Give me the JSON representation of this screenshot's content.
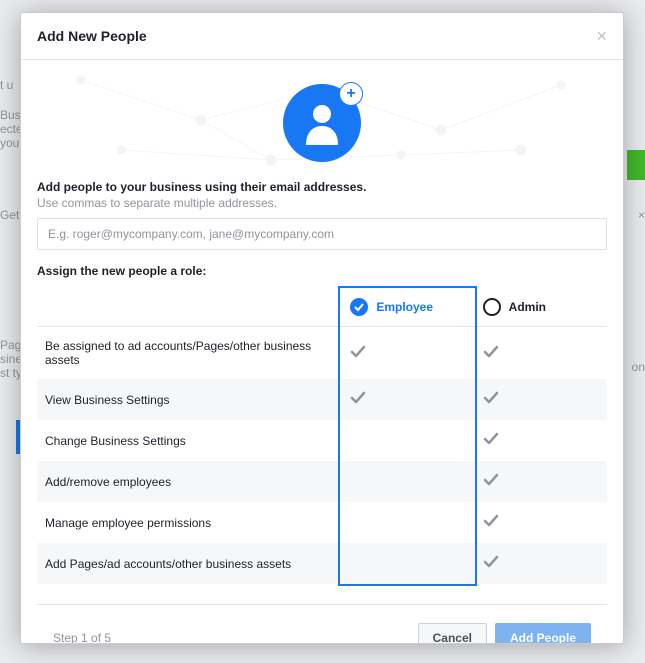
{
  "header": {
    "title": "Add New People"
  },
  "body": {
    "instruction_title": "Add people to your business using their email addresses.",
    "instruction_sub": "Use commas to separate multiple addresses.",
    "email_placeholder": "E.g. roger@mycompany.com, jane@mycompany.com",
    "assign_label": "Assign the new people a role:"
  },
  "roles": {
    "employee_label": "Employee",
    "admin_label": "Admin",
    "selected": "employee"
  },
  "permissions": [
    {
      "label": "Be assigned to ad accounts/Pages/other business assets",
      "employee": true,
      "admin": true
    },
    {
      "label": "View Business Settings",
      "employee": true,
      "admin": true
    },
    {
      "label": "Change Business Settings",
      "employee": false,
      "admin": true
    },
    {
      "label": "Add/remove employees",
      "employee": false,
      "admin": true
    },
    {
      "label": "Manage employee permissions",
      "employee": false,
      "admin": true
    },
    {
      "label": "Add Pages/ad accounts/other business assets",
      "employee": false,
      "admin": true
    }
  ],
  "footer": {
    "step_label": "Step 1 of 5",
    "cancel_label": "Cancel",
    "confirm_label": "Add People"
  }
}
